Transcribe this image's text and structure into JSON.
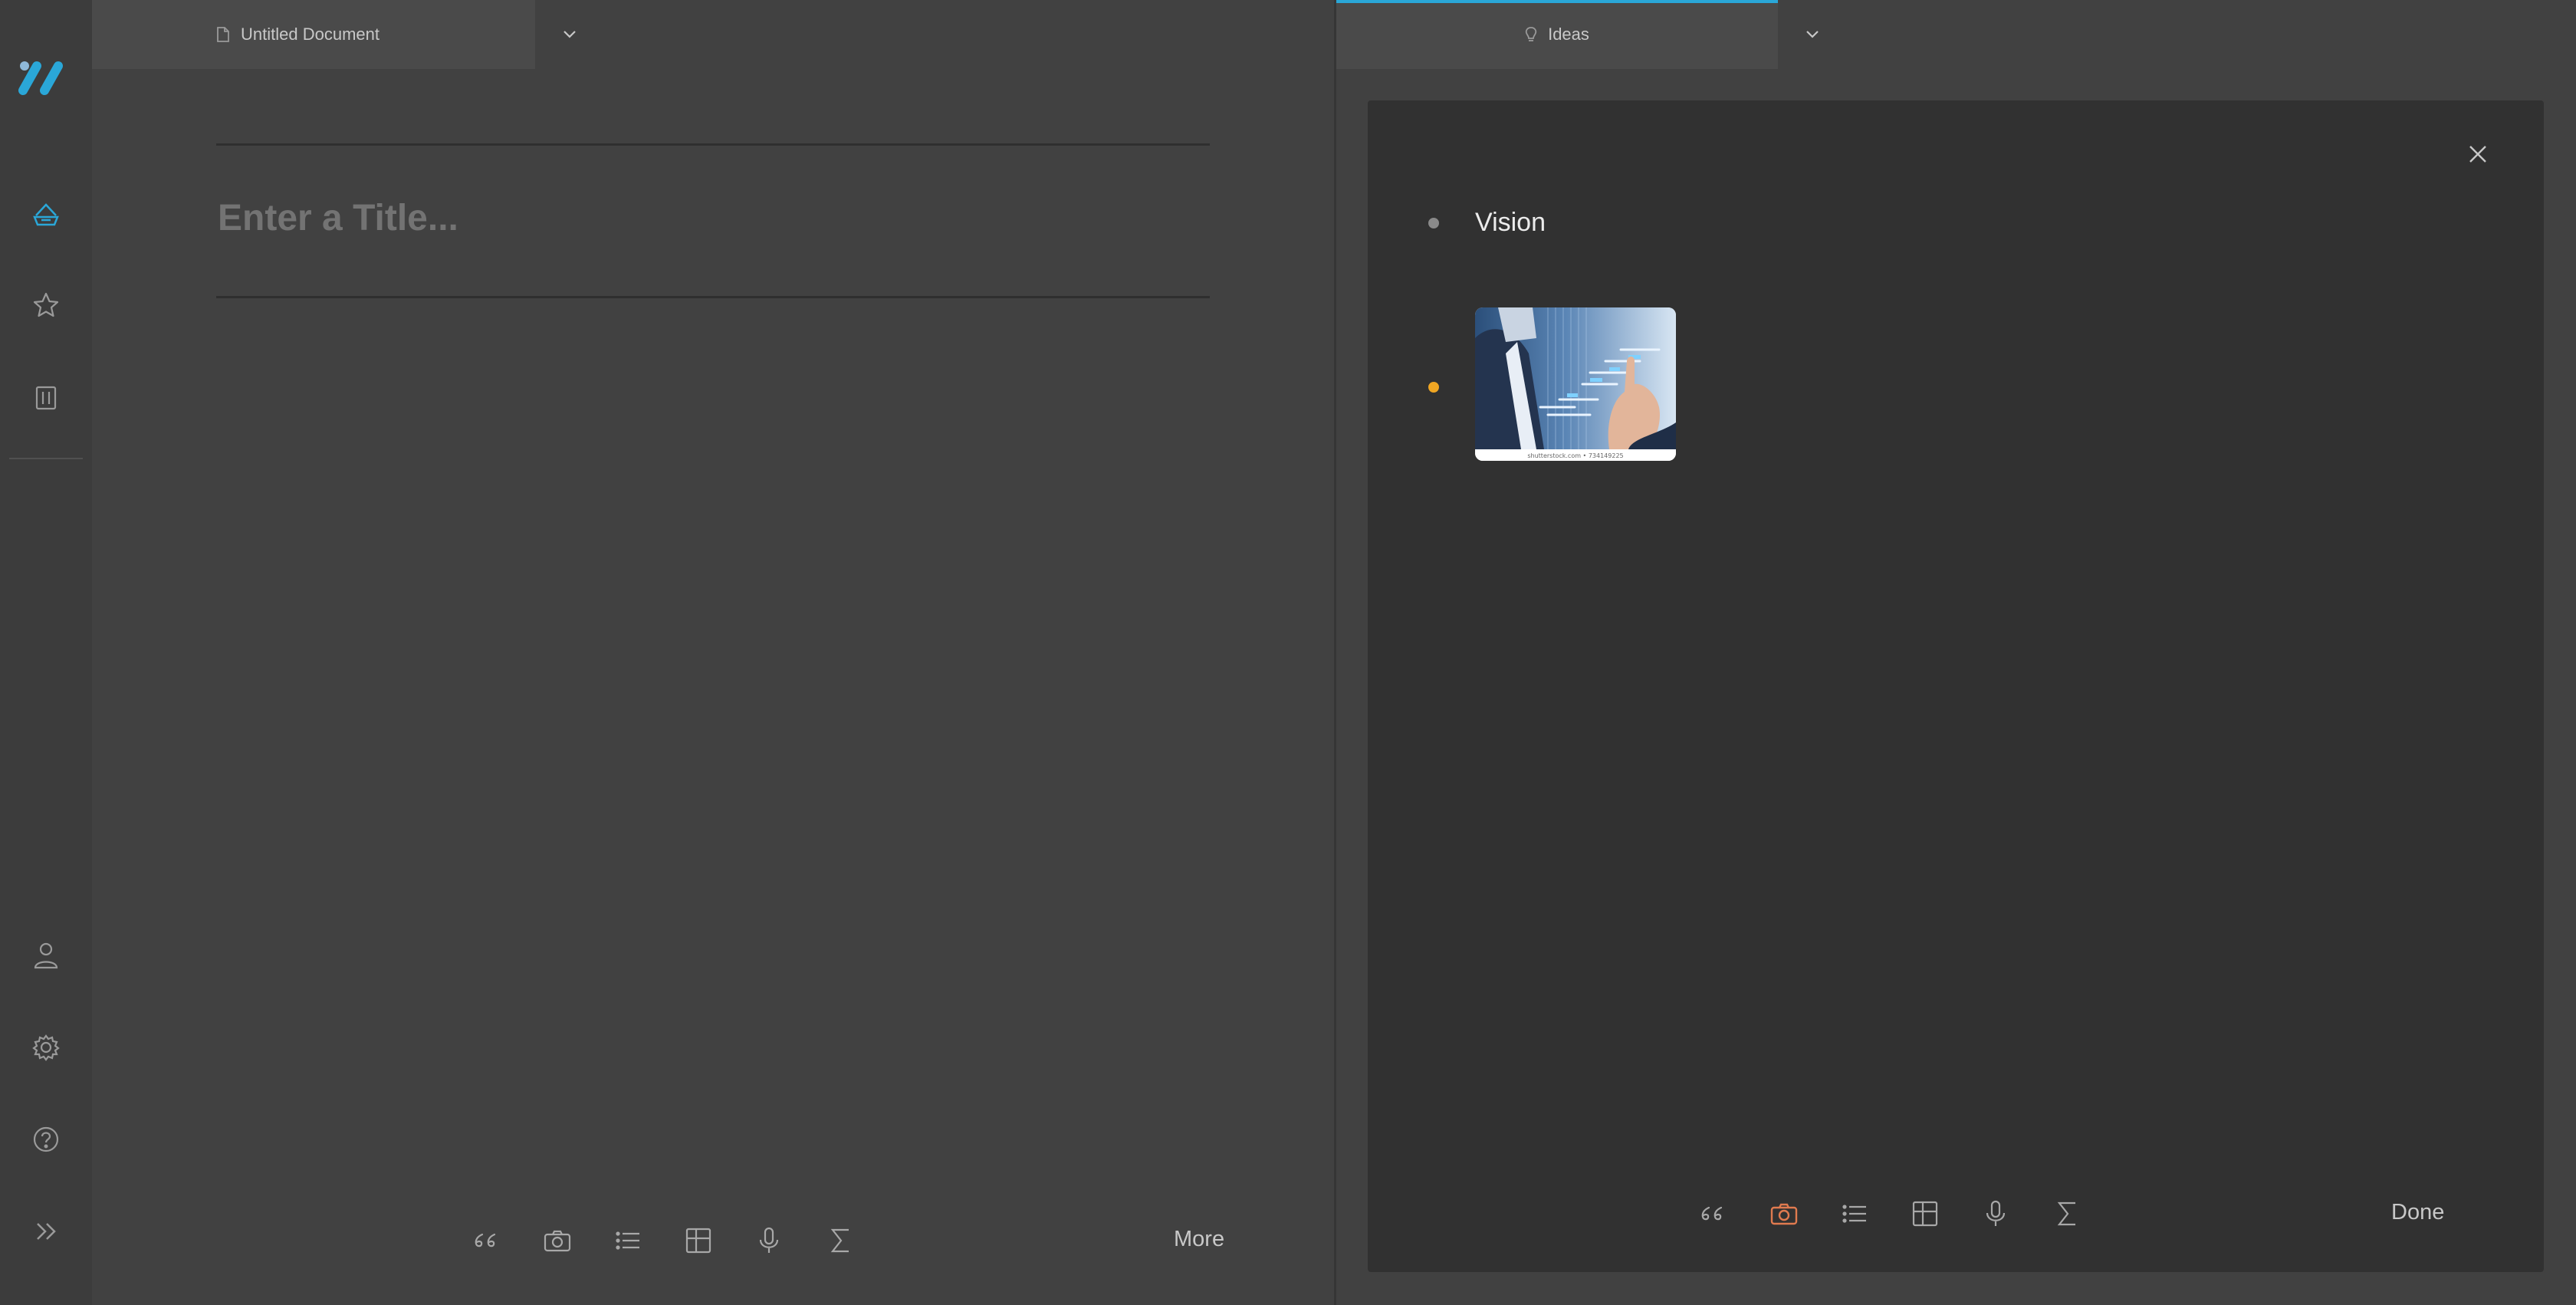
{
  "app": {
    "logo": "app-logo"
  },
  "sidebar": {
    "items": [
      {
        "name": "home",
        "icon": "home-icon",
        "active": true
      },
      {
        "name": "favorites",
        "icon": "star-icon"
      },
      {
        "name": "trash",
        "icon": "trash-icon"
      }
    ],
    "bottom_items": [
      {
        "name": "account",
        "icon": "user-icon"
      },
      {
        "name": "settings",
        "icon": "gear-icon"
      },
      {
        "name": "help",
        "icon": "help-icon"
      },
      {
        "name": "expand",
        "icon": "double-chevron-right-icon"
      }
    ]
  },
  "left_tab": {
    "icon": "document-icon",
    "label": "Untitled Document"
  },
  "right_tab": {
    "icon": "lightbulb-icon",
    "label": "Ideas",
    "active_color": "#2aa7d8"
  },
  "editor": {
    "title_placeholder": "Enter a Title..."
  },
  "left_toolbar": {
    "tools": [
      "quote-icon",
      "camera-icon",
      "list-icon",
      "table-icon",
      "microphone-icon",
      "sum-icon"
    ],
    "more_label": "More"
  },
  "ideas": {
    "items": [
      {
        "type": "text",
        "text": "Vision",
        "bullet_color": "#8a8a8a"
      },
      {
        "type": "image",
        "image_caption": "shutterstock.com • 734149225",
        "bullet_color": "#f0a623"
      }
    ],
    "toolbar": {
      "tools": [
        "quote-icon",
        "camera-icon",
        "list-icon",
        "table-icon",
        "microphone-icon",
        "sum-icon"
      ],
      "active_tool": "camera-icon",
      "active_color": "#e07a4f",
      "done_label": "Done"
    }
  },
  "colors": {
    "accent_blue": "#2aa7d8",
    "background": "#414141",
    "modal": "#313131"
  }
}
